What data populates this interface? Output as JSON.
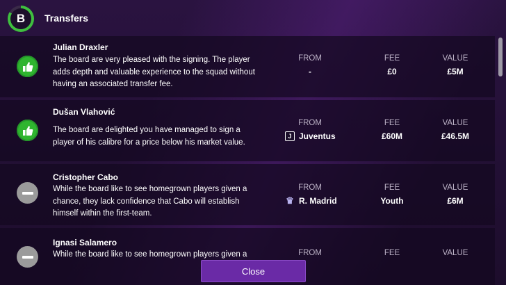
{
  "header": {
    "grade": "B",
    "title": "Transfers"
  },
  "columns": {
    "from": "FROM",
    "fee": "FEE",
    "value": "VALUE"
  },
  "rows": [
    {
      "icon": "thumbs-up-icon",
      "name": "Julian Draxler",
      "description": "The board are very pleased with the signing. The player adds depth and valuable experience to the squad without having an associated transfer fee.",
      "from": "-",
      "club_badge": "",
      "fee": "£0",
      "value": "£5M"
    },
    {
      "icon": "thumbs-up-icon",
      "name": "Dušan Vlahović",
      "description": "The board are delighted you have managed to sign a player of his calibre for a price below his market value.",
      "from": "Juventus",
      "club_badge": "J",
      "fee": "£60M",
      "value": "£46.5M"
    },
    {
      "icon": "minus-icon",
      "name": "Cristopher Cabo",
      "description": "While the board like to see homegrown players given a chance, they lack confidence that Cabo will establish himself within the first-team.",
      "from": "R. Madrid",
      "club_badge": "♛",
      "fee": "Youth",
      "value": "£6M"
    },
    {
      "icon": "minus-icon",
      "name": "Ignasi Salamero",
      "description": "While the board like to see homegrown players given a",
      "from": "",
      "club_badge": "",
      "fee": "",
      "value": ""
    }
  ],
  "close_label": "Close",
  "colors": {
    "accent": "#6a2aa6",
    "good": "#2fb52f",
    "neutral": "#9b9b9b",
    "grade_ring": "#3fbf3f"
  }
}
